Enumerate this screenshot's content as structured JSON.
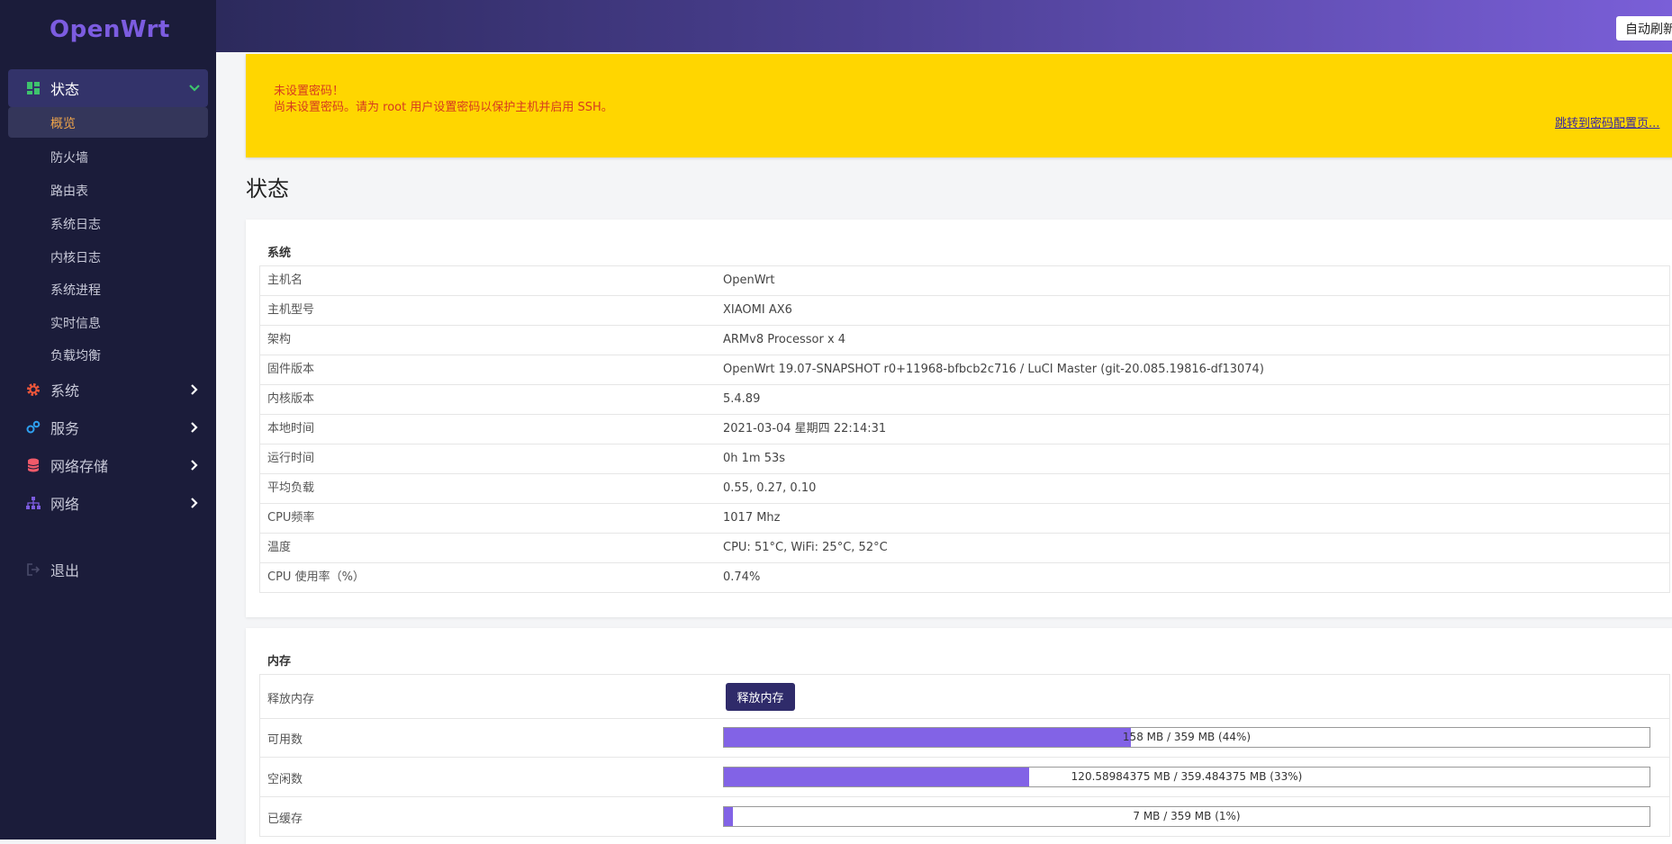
{
  "sidebar": {
    "logo": "OpenWrt",
    "menu": {
      "status": "状态",
      "system": "系统",
      "services": "服务",
      "nas": "网络存储",
      "network": "网络",
      "logout": "退出"
    },
    "status_items": [
      "概览",
      "防火墙",
      "路由表",
      "系统日志",
      "内核日志",
      "系统进程",
      "实时信息",
      "负载均衡"
    ],
    "icon_colors": {
      "status": "#3ec46d",
      "system": "#f0573a",
      "services": "#2ea0f0",
      "nas": "#f05a6a",
      "network": "#7c5ce0"
    }
  },
  "header": {
    "refresh_button": "自动刷新"
  },
  "alert": {
    "title": "未设置密码！",
    "message": "尚未设置密码。请为 root 用户设置密码以保护主机并启用 SSH。",
    "link": "跳转到密码配置页..."
  },
  "page": {
    "title": "状态"
  },
  "system": {
    "title": "系统",
    "rows": [
      {
        "key": "主机名",
        "value": "OpenWrt"
      },
      {
        "key": "主机型号",
        "value": "XIAOMI AX6"
      },
      {
        "key": "架构",
        "value": "ARMv8 Processor x 4"
      },
      {
        "key": "固件版本",
        "value": "OpenWrt 19.07-SNAPSHOT r0+11968-bfbcb2c716 / LuCI Master (git-20.085.19816-df13074)"
      },
      {
        "key": "内核版本",
        "value": "5.4.89"
      },
      {
        "key": "本地时间",
        "value": "2021-03-04 星期四 22:14:31"
      },
      {
        "key": "运行时间",
        "value": "0h 1m 53s"
      },
      {
        "key": "平均负载",
        "value": "0.55, 0.27, 0.10"
      },
      {
        "key": "CPU频率",
        "value": "1017 Mhz"
      },
      {
        "key": "温度",
        "value": "CPU: 51°C, WiFi: 25°C, 52°C"
      },
      {
        "key": "CPU 使用率（%）",
        "value": "0.74%"
      }
    ]
  },
  "memory": {
    "title": "内存",
    "free_label": "释放内存",
    "free_button": "释放内存",
    "bars": [
      {
        "key": "可用数",
        "text": "158 MB / 359 MB (44%)",
        "percent": 44
      },
      {
        "key": "空闲数",
        "text": "120.58984375 MB / 359.484375 MB (33%)",
        "percent": 33
      },
      {
        "key": "已缓存",
        "text": "7 MB / 359 MB (1%)",
        "percent": 1
      }
    ]
  }
}
